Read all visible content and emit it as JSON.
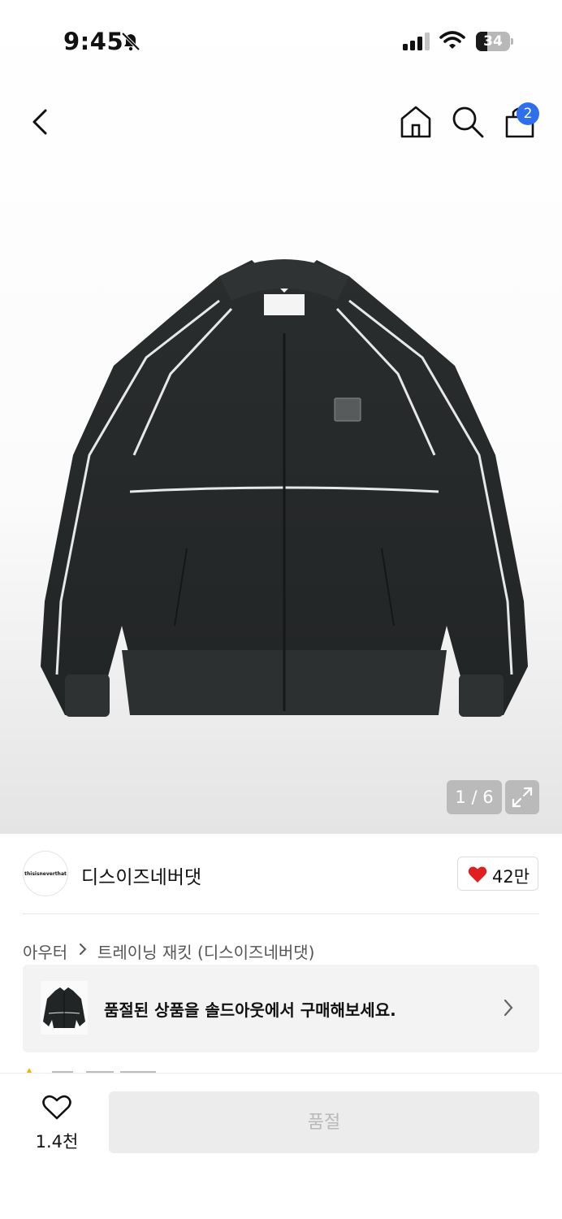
{
  "status_bar": {
    "time": "9:45",
    "battery_level": "34",
    "battery_fraction": 0.34
  },
  "nav": {
    "back_icon": "chevron-left-icon",
    "home_icon": "home-icon",
    "search_icon": "search-icon",
    "bag_icon": "shopping-bag-icon",
    "bag_count": "2"
  },
  "gallery": {
    "counter": "1 / 6",
    "expand_icon": "expand-icon"
  },
  "brand": {
    "logo_text": "thisisneverthat",
    "name": "디스이즈네버댓",
    "likes": "42만"
  },
  "breadcrumb": {
    "category": "아우터",
    "subcategory": "트레이닝 재킷 (디스이즈네버댓)"
  },
  "soldout": {
    "message": "품절된 상품을 솔드아웃에서 구매해보세요."
  },
  "bottom": {
    "wish_count": "1.4천",
    "buy_label": "품절"
  },
  "colors": {
    "accent_blue": "#2f6fed",
    "heart_red": "#e02020",
    "disabled_bg": "#ececec",
    "disabled_text": "#b9b9b9"
  }
}
